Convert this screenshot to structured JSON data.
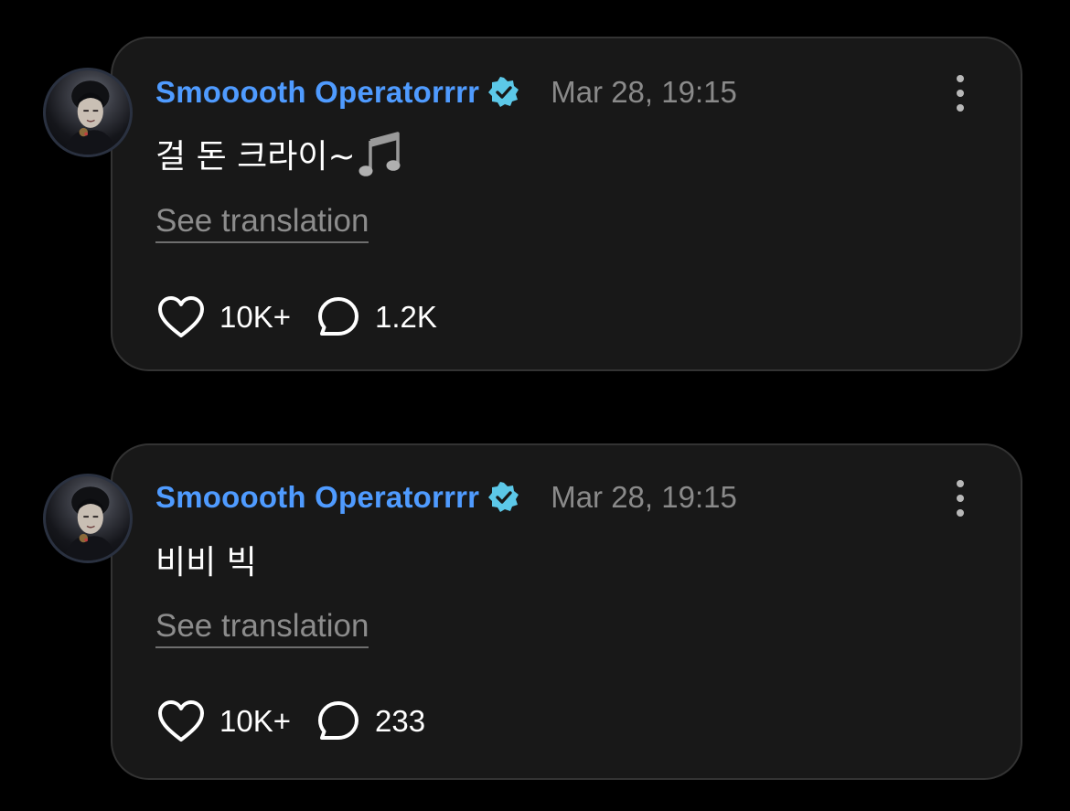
{
  "posts": [
    {
      "author": "Smooooth Operatorrrr",
      "verified": true,
      "timestamp": "Mar 28, 19:15",
      "text": "걸 돈 크라이~",
      "text_icon": "music-note-icon",
      "translate_label": "See translation",
      "likes": "10K+",
      "comments": "1.2K"
    },
    {
      "author": "Smooooth Operatorrrr",
      "verified": true,
      "timestamp": "Mar 28, 19:15",
      "text": "비비 빅",
      "translate_label": "See translation",
      "likes": "10K+",
      "comments": "233"
    }
  ],
  "colors": {
    "background": "#000000",
    "card": "#181818",
    "card_border": "#333333",
    "author": "#4f9bff",
    "verified_badge": "#5cc8e8",
    "muted_text": "#8a8a8a"
  }
}
